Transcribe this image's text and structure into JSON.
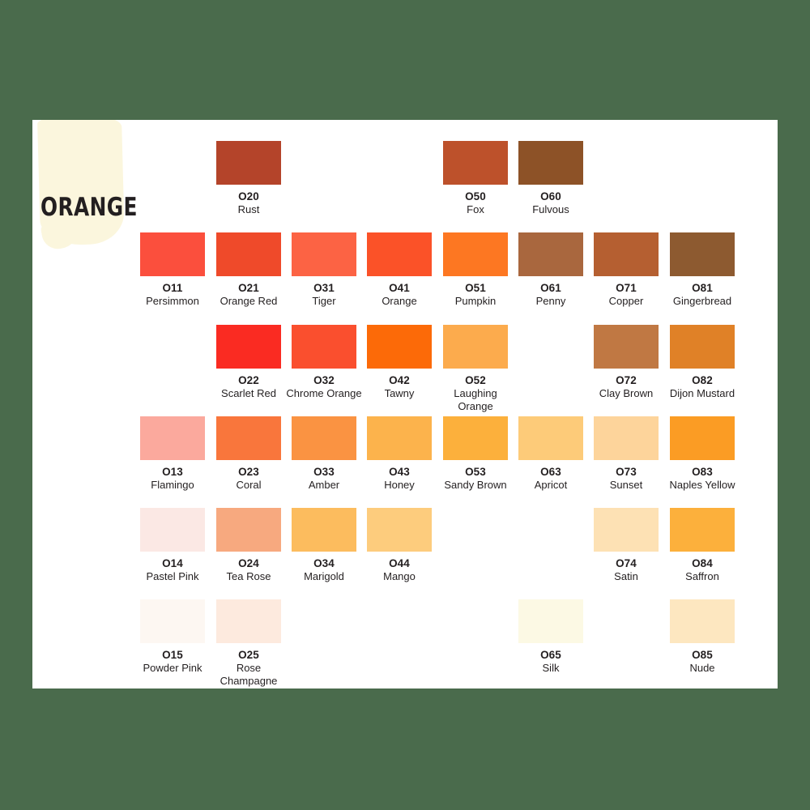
{
  "background_color": "#4a6b4c",
  "card": {
    "background_color": "#ffffff",
    "title": "ORANGE",
    "paint_stroke_color": "#fbf6dd"
  },
  "legend": {
    "code_color": "#231f20",
    "name_color": "#231f20"
  },
  "columns": 8,
  "rows": 6,
  "swatches": [
    {
      "code": "O20",
      "name": "Rust",
      "hex": "#b4442a",
      "row": 0,
      "col": 2
    },
    {
      "code": "O50",
      "name": "Fox",
      "hex": "#bd512b",
      "row": 0,
      "col": 5
    },
    {
      "code": "O60",
      "name": "Fulvous",
      "hex": "#8d5227",
      "row": 0,
      "col": 6
    },
    {
      "code": "O11",
      "name": "Persimmon",
      "hex": "#fb4f3d",
      "row": 1,
      "col": 1
    },
    {
      "code": "O21",
      "name": "Orange Red",
      "hex": "#ef4a2a",
      "row": 1,
      "col": 2
    },
    {
      "code": "O31",
      "name": "Tiger",
      "hex": "#fc6344",
      "row": 1,
      "col": 3
    },
    {
      "code": "O41",
      "name": "Orange",
      "hex": "#fb5228",
      "row": 1,
      "col": 4
    },
    {
      "code": "O51",
      "name": "Pumpkin",
      "hex": "#fd7722",
      "row": 1,
      "col": 5
    },
    {
      "code": "O61",
      "name": "Penny",
      "hex": "#a9673e",
      "row": 1,
      "col": 6
    },
    {
      "code": "O71",
      "name": "Copper",
      "hex": "#b55f31",
      "row": 1,
      "col": 7
    },
    {
      "code": "O81",
      "name": "Gingerbread",
      "hex": "#8d5a30",
      "row": 1,
      "col": 8
    },
    {
      "code": "O22",
      "name": "Scarlet Red",
      "hex": "#fa2b22",
      "row": 2,
      "col": 2
    },
    {
      "code": "O32",
      "name": "Chrome Orange",
      "hex": "#fa4f2e",
      "row": 2,
      "col": 3
    },
    {
      "code": "O42",
      "name": "Tawny",
      "hex": "#fc6a08",
      "row": 2,
      "col": 4
    },
    {
      "code": "O52",
      "name": "Laughing Orange",
      "hex": "#fcab4d",
      "row": 2,
      "col": 5
    },
    {
      "code": "O72",
      "name": "Clay Brown",
      "hex": "#c07843",
      "row": 2,
      "col": 7
    },
    {
      "code": "O82",
      "name": "Dijon Mustard",
      "hex": "#e08127",
      "row": 2,
      "col": 8
    },
    {
      "code": "O13",
      "name": "Flamingo",
      "hex": "#fba99d",
      "row": 3,
      "col": 1
    },
    {
      "code": "O23",
      "name": "Coral",
      "hex": "#f9763c",
      "row": 3,
      "col": 2
    },
    {
      "code": "O33",
      "name": "Amber",
      "hex": "#fa9342",
      "row": 3,
      "col": 3
    },
    {
      "code": "O43",
      "name": "Honey",
      "hex": "#fcb34c",
      "row": 3,
      "col": 4
    },
    {
      "code": "O53",
      "name": "Sandy Brown",
      "hex": "#fcb03c",
      "row": 3,
      "col": 5
    },
    {
      "code": "O63",
      "name": "Apricot",
      "hex": "#fdcb79",
      "row": 3,
      "col": 6
    },
    {
      "code": "O73",
      "name": "Sunset",
      "hex": "#fdd49b",
      "row": 3,
      "col": 7
    },
    {
      "code": "O83",
      "name": "Naples Yellow",
      "hex": "#fb9c24",
      "row": 3,
      "col": 8
    },
    {
      "code": "O14",
      "name": "Pastel Pink",
      "hex": "#fbe8e4",
      "row": 4,
      "col": 1
    },
    {
      "code": "O24",
      "name": "Tea Rose",
      "hex": "#f7a97f",
      "row": 4,
      "col": 2
    },
    {
      "code": "O34",
      "name": "Marigold",
      "hex": "#fcbc5e",
      "row": 4,
      "col": 3
    },
    {
      "code": "O44",
      "name": "Mango",
      "hex": "#fdcc7d",
      "row": 4,
      "col": 4
    },
    {
      "code": "O74",
      "name": "Satin",
      "hex": "#fde1b4",
      "row": 4,
      "col": 7
    },
    {
      "code": "O84",
      "name": "Saffron",
      "hex": "#fcb03c",
      "row": 4,
      "col": 8
    },
    {
      "code": "O15",
      "name": "Powder Pink",
      "hex": "#fdf7f2",
      "row": 5,
      "col": 1
    },
    {
      "code": "O25",
      "name": "Rose Champagne",
      "hex": "#fdeade",
      "row": 5,
      "col": 2
    },
    {
      "code": "O65",
      "name": "Silk",
      "hex": "#fcf9e4",
      "row": 5,
      "col": 6
    },
    {
      "code": "O85",
      "name": "Nude",
      "hex": "#fde7c0",
      "row": 5,
      "col": 8
    }
  ]
}
